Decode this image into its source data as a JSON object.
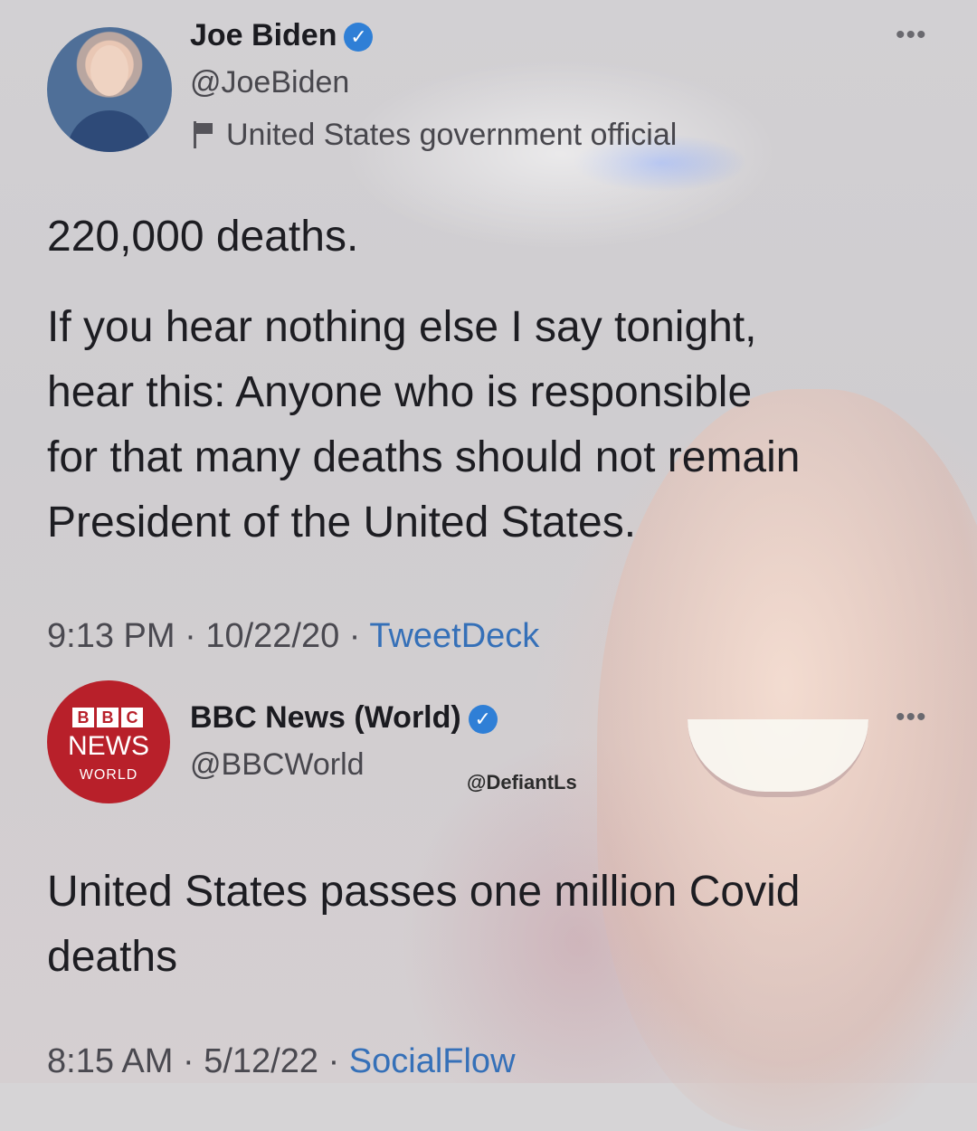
{
  "tweet1": {
    "name": "Joe Biden",
    "handle": "@JoeBiden",
    "label": "United States government official",
    "text_line1": "220,000 deaths.",
    "text_body": [
      "If you hear nothing else I say tonight,",
      "hear this: Anyone who is responsible",
      "for that many deaths should not remain",
      "President of the United States."
    ],
    "time": "9:13 PM",
    "date": "10/22/20",
    "source": "TweetDeck"
  },
  "tweet2": {
    "name": "BBC News (World)",
    "handle": "@BBCWorld",
    "avatar": {
      "blocks": [
        "B",
        "B",
        "C"
      ],
      "line1": "NEWS",
      "line2": "WORLD"
    },
    "text_body": [
      "United States passes one million Covid",
      "deaths"
    ],
    "time": "8:15 AM",
    "date": "5/12/22",
    "source": "SocialFlow"
  },
  "watermark": "@DefiantLs",
  "separator": "·",
  "verified_glyph": "✓",
  "more_glyph": "•••",
  "colors": {
    "verified": "#2f7fd6",
    "link": "#3570b8",
    "bbc_red": "#b8202a"
  }
}
